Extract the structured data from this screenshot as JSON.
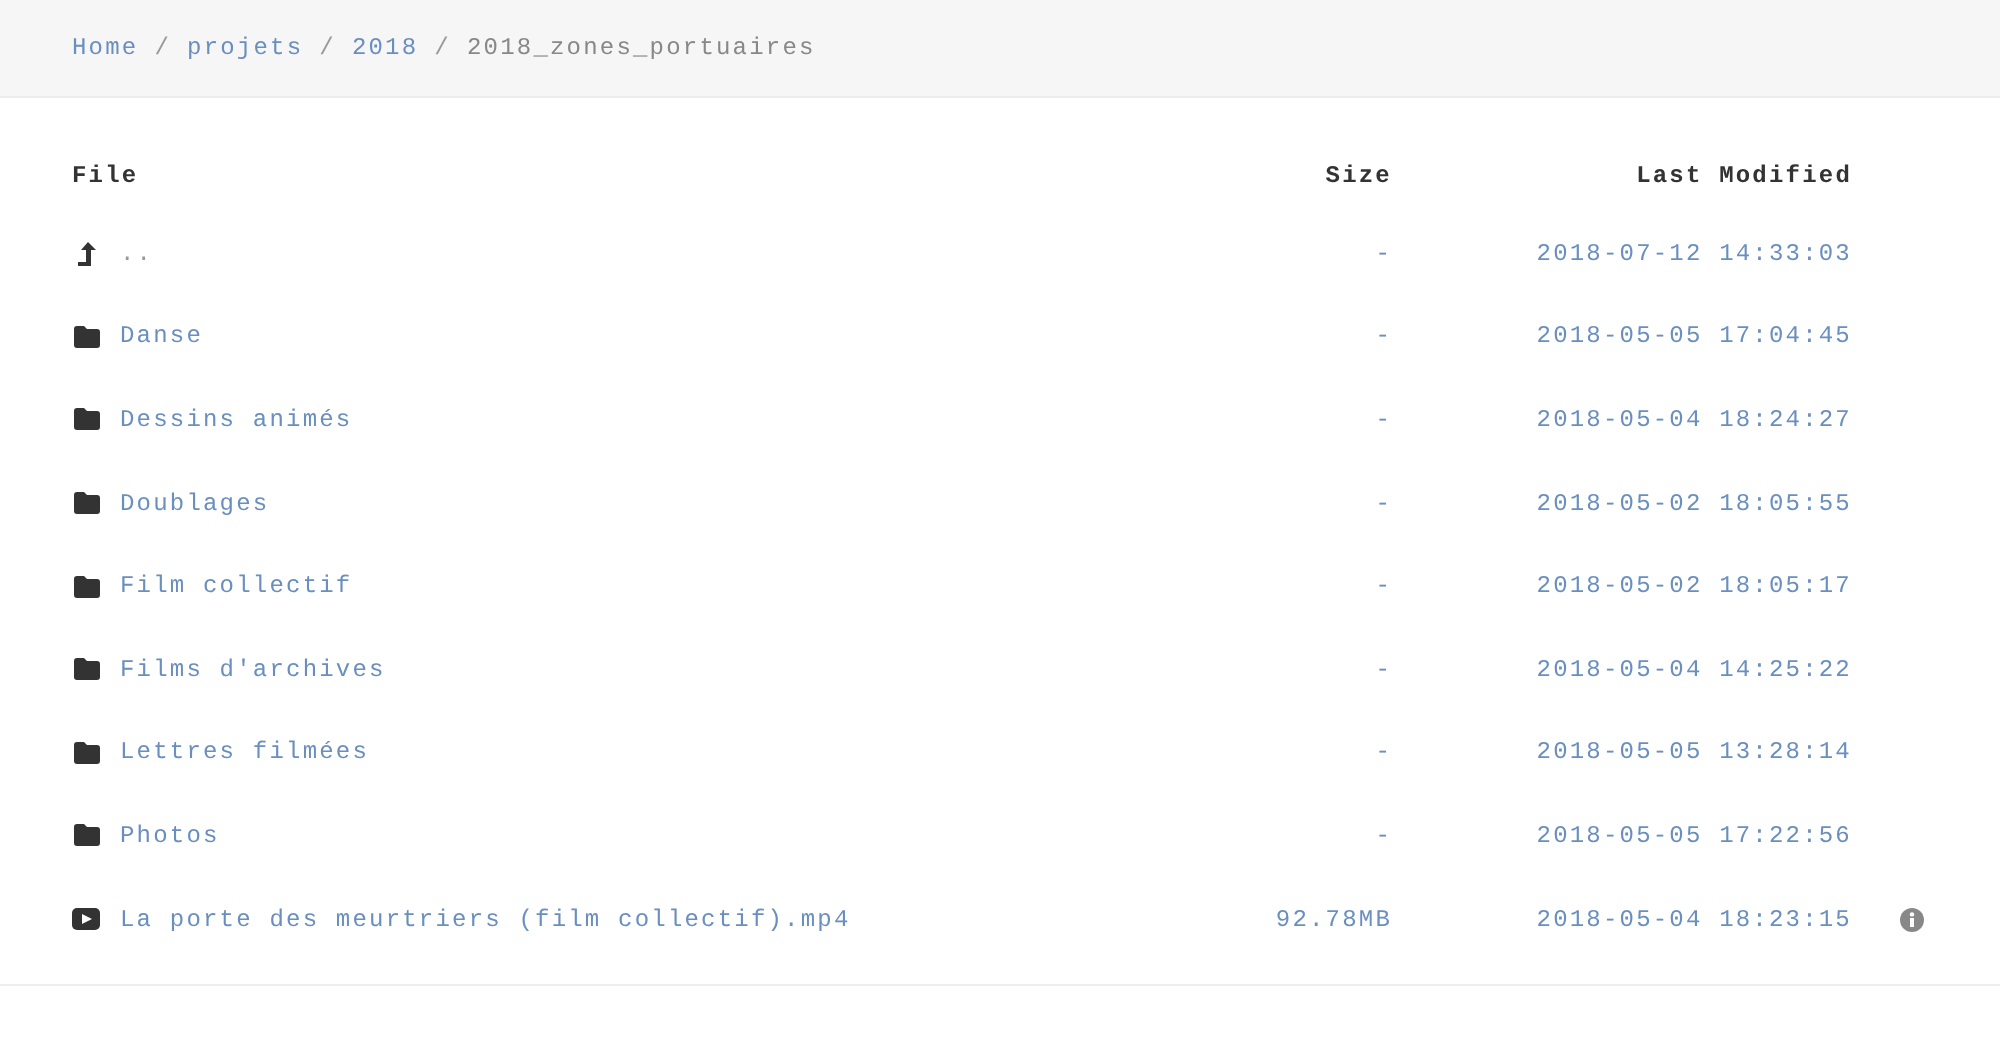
{
  "breadcrumb": [
    {
      "label": "Home",
      "link": true
    },
    {
      "separator": "/",
      "label": "projets",
      "link": true
    },
    {
      "separator": "/",
      "label": "2018",
      "link": true
    },
    {
      "separator": "/",
      "label": "2018_zones_portuaires",
      "link": false
    }
  ],
  "table": {
    "columns": [
      "File",
      "Size",
      "Last Modified"
    ],
    "rows": [
      {
        "kind": "parent",
        "name": "..",
        "size": "-",
        "modified": "2018-07-12 14:33:03",
        "info": false
      },
      {
        "kind": "folder",
        "name": "Danse",
        "size": "-",
        "modified": "2018-05-05 17:04:45",
        "info": false
      },
      {
        "kind": "folder",
        "name": "Dessins animés",
        "size": "-",
        "modified": "2018-05-04 18:24:27",
        "info": false
      },
      {
        "kind": "folder",
        "name": "Doublages",
        "size": "-",
        "modified": "2018-05-02 18:05:55",
        "info": false
      },
      {
        "kind": "folder",
        "name": "Film collectif",
        "size": "-",
        "modified": "2018-05-02 18:05:17",
        "info": false
      },
      {
        "kind": "folder",
        "name": "Films d'archives",
        "size": "-",
        "modified": "2018-05-04 14:25:22",
        "info": false
      },
      {
        "kind": "folder",
        "name": "Lettres filmées",
        "size": "-",
        "modified": "2018-05-05 13:28:14",
        "info": false
      },
      {
        "kind": "folder",
        "name": "Photos",
        "size": "-",
        "modified": "2018-05-05 17:22:56",
        "info": false
      },
      {
        "kind": "video",
        "name": "La porte des meurtriers (film collectif).mp4",
        "size": "92.78MB",
        "modified": "2018-05-04 18:23:15",
        "info": true
      }
    ]
  }
}
